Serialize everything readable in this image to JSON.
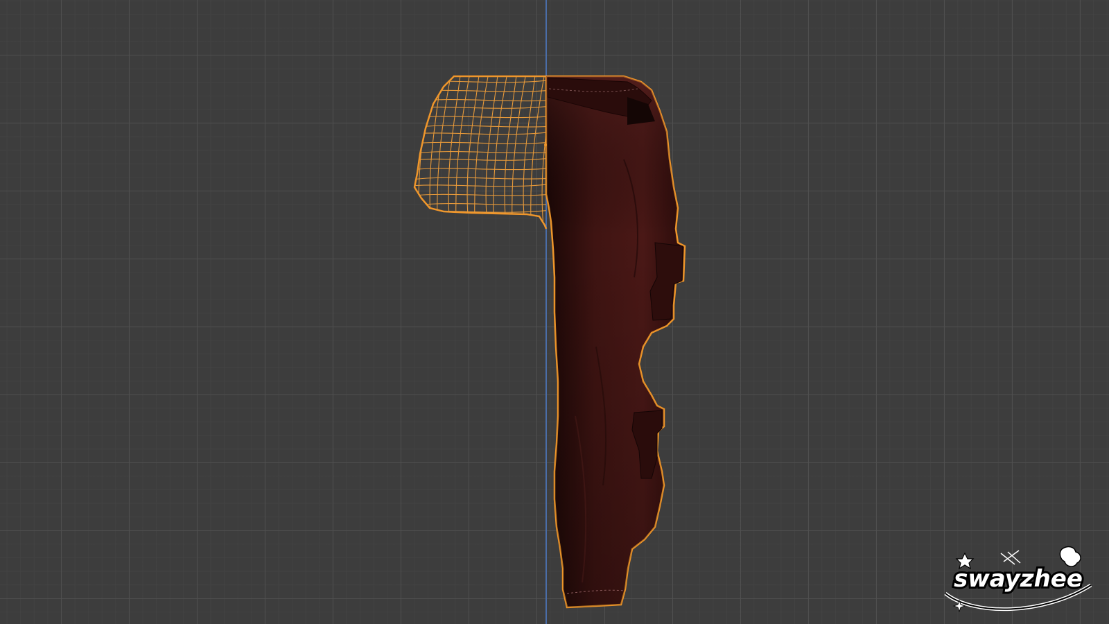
{
  "viewport": {
    "background_color": "#3d3d3d",
    "grid_color": "#505050",
    "axis_color": "#4a6da8"
  },
  "object": {
    "selection_outline_color": "#f0962a",
    "wireframe_color": "#e89a3a",
    "material_color": "#4a1715"
  },
  "watermark": {
    "text": "swayzhee",
    "icon": "star-sparkle-icon"
  }
}
